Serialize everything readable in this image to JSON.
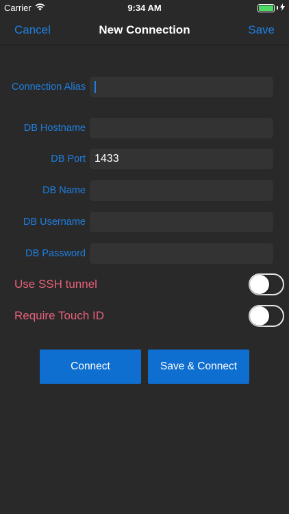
{
  "status_bar": {
    "carrier": "Carrier",
    "time": "9:34 AM"
  },
  "nav": {
    "cancel_label": "Cancel",
    "title": "New Connection",
    "save_label": "Save"
  },
  "form": {
    "fields": [
      {
        "label": "Connection Alias",
        "value": ""
      },
      {
        "label": "DB Hostname",
        "value": ""
      },
      {
        "label": "DB Port",
        "value": "1433"
      },
      {
        "label": "DB Name",
        "value": ""
      },
      {
        "label": "DB Username",
        "value": ""
      },
      {
        "label": "DB Password",
        "value": ""
      }
    ]
  },
  "toggles": [
    {
      "label": "Use SSH tunnel",
      "on": false
    },
    {
      "label": "Require Touch ID",
      "on": false
    }
  ],
  "buttons": {
    "connect_label": "Connect",
    "save_connect_label": "Save & Connect"
  },
  "colors": {
    "accent": "#1f7fe0",
    "toggle_label": "#e7607a",
    "button_bg": "#0f6fd1",
    "background": "#292929",
    "battery": "#4cd964"
  }
}
